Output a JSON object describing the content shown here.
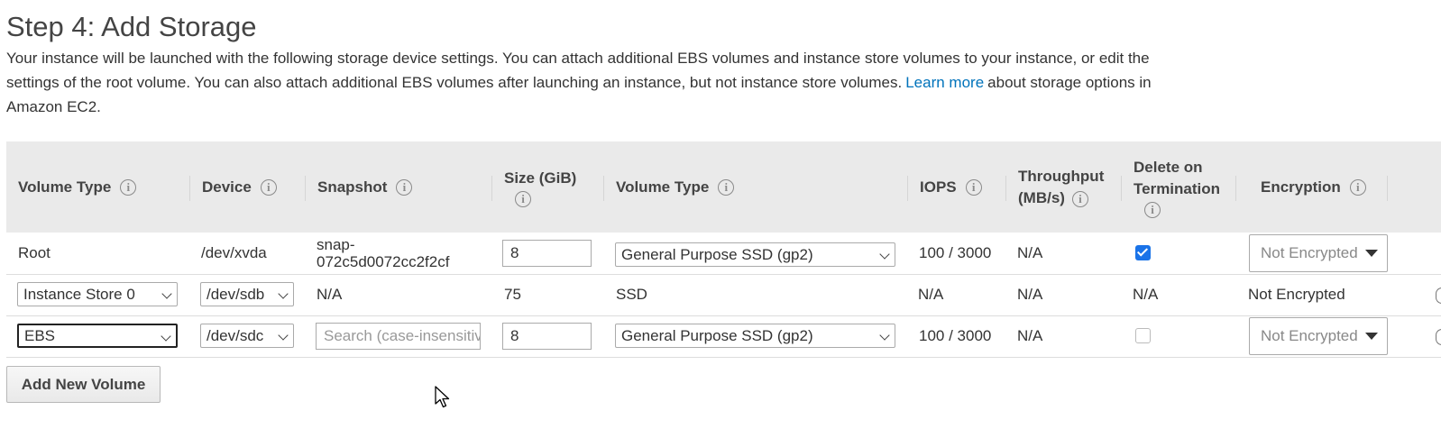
{
  "page": {
    "title": "Step 4: Add Storage",
    "description_before_link": "Your instance will be launched with the following storage device settings. You can attach additional EBS volumes and instance store volumes to your instance, or edit the settings of the root volume. You can also attach additional EBS volumes after launching an instance, but not instance store volumes.",
    "link_label": "Learn more",
    "description_after_link": "about storage options in Amazon EC2."
  },
  "columns": {
    "volume_type": "Volume Type",
    "device": "Device",
    "snapshot": "Snapshot",
    "size_line1": "Size (GiB)",
    "volume_type2": "Volume Type",
    "iops": "IOPS",
    "throughput_line1": "Throughput",
    "throughput_line2": "(MB/s)",
    "delete_line1": "Delete on",
    "delete_line2": "Termination",
    "encryption": "Encryption"
  },
  "info_icon_glyph": "i",
  "rows": [
    {
      "volume_type": "Root",
      "device": "/dev/xvda",
      "snapshot": "snap-072c5d0072cc2f2cf",
      "size": "8",
      "ebs_type": "General Purpose SSD (gp2)",
      "iops": "100 / 3000",
      "throughput": "N/A",
      "delete_on_termination": true,
      "encryption": "Not Encrypted"
    },
    {
      "volume_type": "Instance Store 0",
      "device": "/dev/sdb",
      "snapshot": "N/A",
      "size": "75",
      "ebs_type": "SSD",
      "iops": "N/A",
      "throughput": "N/A",
      "delete_on_termination": "N/A",
      "encryption": "Not Encrypted"
    },
    {
      "volume_type": "EBS",
      "device": "/dev/sdc",
      "snapshot_placeholder": "Search (case-insensitive)",
      "size": "8",
      "ebs_type": "General Purpose SSD (gp2)",
      "iops": "100 / 3000",
      "throughput": "N/A",
      "delete_on_termination": false,
      "encryption": "Not Encrypted"
    }
  ],
  "buttons": {
    "add_volume": "Add New Volume"
  },
  "colors": {
    "header_bg": "#eaeaea",
    "link": "#0073bb",
    "checkbox_checked": "#1a73e8"
  }
}
